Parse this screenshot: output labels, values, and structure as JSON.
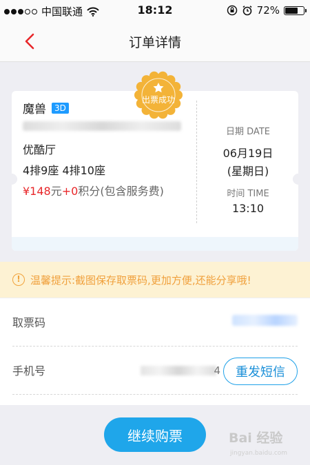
{
  "status_bar": {
    "carrier": "中国联通",
    "time": "18:12",
    "battery": "72%",
    "battery_level": 0.72,
    "signal_bars": 3,
    "signal_total": 5
  },
  "nav": {
    "title": "订单详情"
  },
  "ticket": {
    "movie_title": "魔兽",
    "format_badge": "3D",
    "stamp_text": "出票成功",
    "hall": "优酷厅",
    "seats": "4排9座 4排10座",
    "price": {
      "amount": "¥148",
      "unit": "元",
      "plus": "+",
      "points": "0",
      "points_suffix": "积分(包含服务费)"
    },
    "date_label": "日期 DATE",
    "date_value": "06月19日",
    "weekday": "(星期日)",
    "time_label": "时间 TIME",
    "time_value": "13:10"
  },
  "tip": {
    "icon": "!",
    "text": "温馨提示:截图保存取票码,更加方便,还能分享哦!"
  },
  "info": {
    "pickup_code_label": "取票码",
    "phone_label": "手机号",
    "phone_tail": "4",
    "resend_label": "重发短信"
  },
  "footer": {
    "continue_label": "继续购票",
    "watermark_text": "Bai 经验",
    "watermark_sub": "jingyan.baidu.com"
  },
  "colors": {
    "accent": "#1fa6ea",
    "price_red": "#e8272a",
    "tip_orange": "#f0a03c",
    "stamp_gold": "#f3b338",
    "badge_blue": "#1e9bff"
  }
}
